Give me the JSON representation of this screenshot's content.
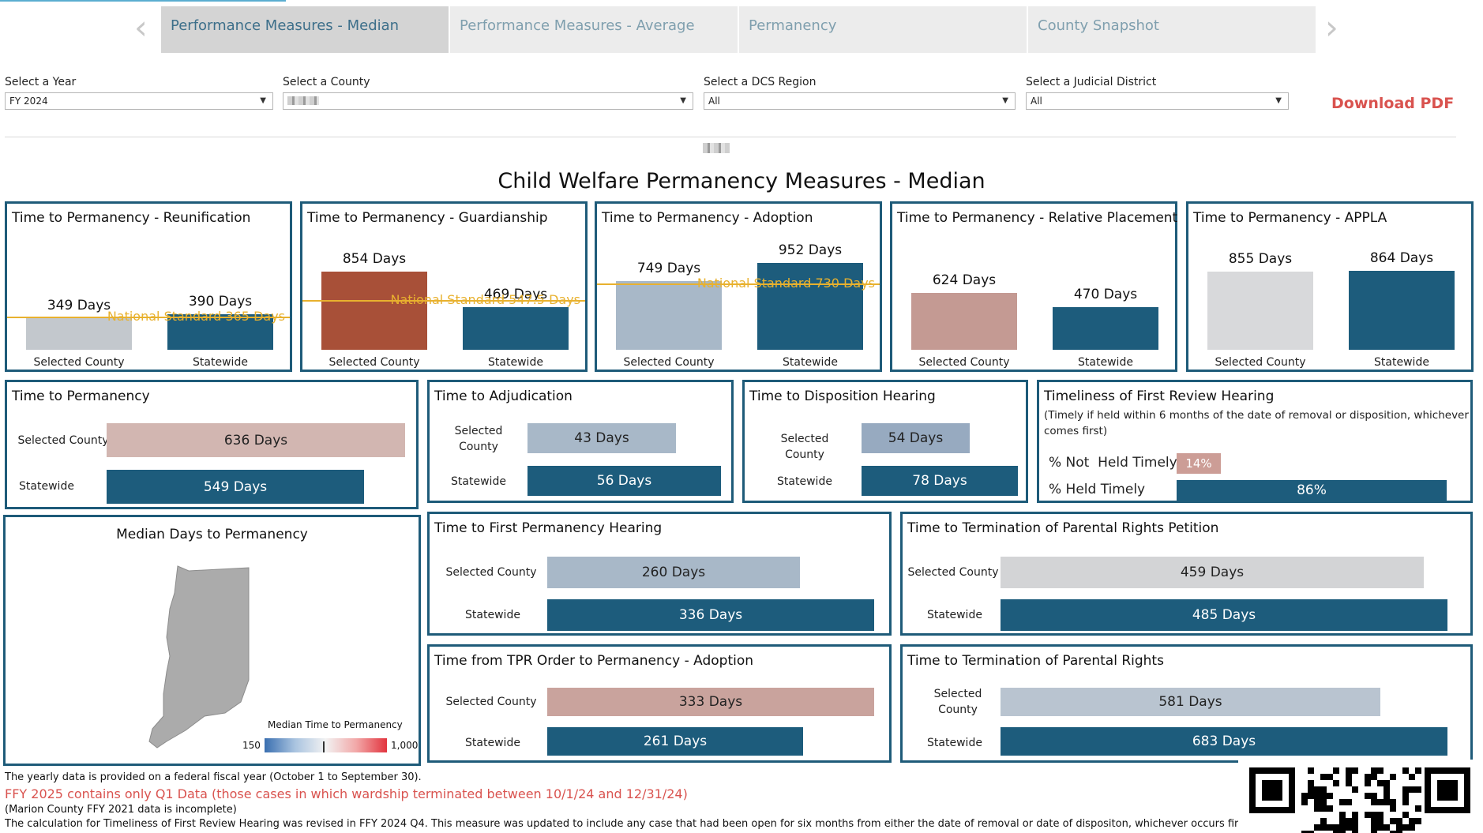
{
  "tabs": [
    {
      "label": "Performance Measures - Median",
      "active": true
    },
    {
      "label": "Performance Measures - Average",
      "active": false
    },
    {
      "label": "Permanency",
      "active": false
    },
    {
      "label": "County Snapshot",
      "active": false
    }
  ],
  "nav": {
    "prev_icon": "chevron-left-icon",
    "next_icon": "chevron-right-icon"
  },
  "filters": {
    "year": {
      "label": "Select a Year",
      "value": "FY 2024"
    },
    "county": {
      "label": "Select a County",
      "value": ""
    },
    "region": {
      "label": "Select a DCS Region",
      "value": "All"
    },
    "district": {
      "label": "Select a Judicial District",
      "value": "All"
    }
  },
  "download_label": "Download PDF",
  "main_title": "Child Welfare Permanency Measures - Median",
  "colors": {
    "panel_border": "#1e5b79",
    "statewide": "#1d5c7c",
    "national_standard": "#e8b12e",
    "accent_red": "#d9534f"
  },
  "vpanels": [
    {
      "title": "Time to Permanency - Reunification",
      "county_label": "349 Days",
      "state_label": "390 Days",
      "county_value": 349,
      "state_value": 390,
      "county_color": "#c3c8cd",
      "standard": 365,
      "standard_label": "National Standard 365 Days",
      "cat_county": "Selected County",
      "cat_state": "Statewide"
    },
    {
      "title": "Time to Permanency - Guardianship",
      "county_label": "854 Days",
      "state_label": "469 Days",
      "county_value": 854,
      "state_value": 469,
      "county_color": "#a85038",
      "standard": 547.5,
      "standard_label": "National Standard 547.5 Days",
      "cat_county": "Selected County",
      "cat_state": "Statewide"
    },
    {
      "title": "Time to Permanency - Adoption",
      "county_label": "749 Days",
      "state_label": "952 Days",
      "county_value": 749,
      "state_value": 952,
      "county_color": "#a8b8c8",
      "standard": 730,
      "standard_label": "National Standard 730 Days",
      "cat_county": "Selected County",
      "cat_state": "Statewide"
    },
    {
      "title": "Time to Permanency - Relative Placement",
      "county_label": "624 Days",
      "state_label": "470 Days",
      "county_value": 624,
      "state_value": 470,
      "county_color": "#c49a93",
      "standard": null,
      "standard_label": "",
      "cat_county": "Selected County",
      "cat_state": "Statewide"
    },
    {
      "title": "Time to Permanency - APPLA",
      "county_label": "855 Days",
      "state_label": "864 Days",
      "county_value": 855,
      "state_value": 864,
      "county_color": "#d8d9db",
      "standard": null,
      "standard_label": "",
      "cat_county": "Selected County",
      "cat_state": "Statewide"
    }
  ],
  "perm": {
    "title": "Time to Permanency",
    "county_label": "Selected County",
    "state_label": "Statewide",
    "county": "636 Days",
    "state": "549 Days",
    "county_value": 636,
    "state_value": 549,
    "county_color": "#d2b6b1"
  },
  "adj": {
    "title": "Time to Adjudication",
    "county_label": "Selected County",
    "state_label": "Statewide",
    "county": "43 Days",
    "state": "56 Days",
    "county_value": 43,
    "state_value": 56,
    "county_color": "#a8b8c8"
  },
  "disp": {
    "title": "Time to Disposition Hearing",
    "county_label": "Selected County",
    "state_label": "Statewide",
    "county": "54 Days",
    "state": "78 Days",
    "county_value": 54,
    "state_value": 78,
    "county_color": "#97aac0"
  },
  "review": {
    "title": "Timeliness of First Review Hearing",
    "subtitle1": "(Timely if held within 6 months of the date of removal or disposition, whichever",
    "subtitle2": "comes first)",
    "not_label": "% Not  Held Timely",
    "held_label": "% Held Timely",
    "not_value": "14%",
    "held_value": "86%",
    "not_pct": 14,
    "held_pct": 86
  },
  "map": {
    "title": "Median Days to Permanency",
    "legend_title": "Median Time to Permanency",
    "legend_min": "150",
    "legend_max": "1,000"
  },
  "fph": {
    "title": "Time to First Permanency Hearing",
    "county_label": "Selected County",
    "state_label": "Statewide",
    "county": "260 Days",
    "state": "336 Days",
    "county_value": 260,
    "state_value": 336,
    "county_color": "#a8b8c8"
  },
  "tprpet": {
    "title": "Time to Termination of Parental Rights Petition",
    "county_label": "Selected County",
    "state_label": "Statewide",
    "county": "459 Days",
    "state": "485 Days",
    "county_value": 459,
    "state_value": 485,
    "county_color": "#d3d4d6"
  },
  "tpradopt": {
    "title": "Time from TPR Order to Permanency - Adoption",
    "county_label": "Selected County",
    "state_label": "Statewide",
    "county": "333 Days",
    "state": "261 Days",
    "county_value": 333,
    "state_value": 261,
    "county_color": "#c9a39d"
  },
  "tpr": {
    "title": "Time to Termination of Parental Rights",
    "county_label": "Selected County",
    "state_label": "Statewide",
    "county": "581 Days",
    "state": "683 Days",
    "county_value": 581,
    "state_value": 683,
    "county_color": "#b9c4d0"
  },
  "notes": [
    "The yearly data is provided on a federal fiscal year (October 1 to September 30).",
    "FFY 2025 contains only Q1 Data (those cases in which wardship terminated between 10/1/24 and 12/31/24)",
    "(Marion County FFY 2021 data is incomplete)",
    "The calculation for Timeliness of First Review Hearing was revised in FFY 2024 Q4. This measure was updated to include any case that had been open for six months from either the date of removal or date of dispositon, whichever occurs first, in which a first review"
  ]
}
